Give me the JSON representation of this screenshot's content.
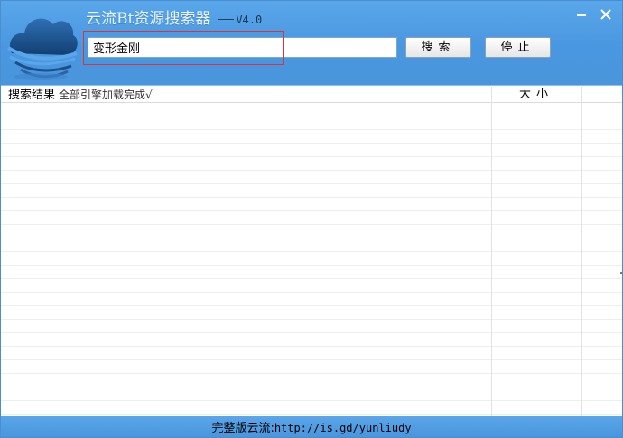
{
  "window": {
    "title": "云流Bt资源搜索器",
    "version": "V4.0"
  },
  "colors": {
    "header_blue": "#4a97e0",
    "highlight_red": "#d2363f",
    "footer_blue": "#4a95dc"
  },
  "icons": {
    "logo": "cloud-logo-icon",
    "minimize": "minimize-icon",
    "close": "close-icon"
  },
  "search": {
    "value": "变形金刚",
    "placeholder": "",
    "search_button": "搜索",
    "stop_button": "停止"
  },
  "results": {
    "header_label": "搜索结果",
    "status": "全部引擎加载完成√",
    "size_column": "大小",
    "rows": []
  },
  "footer": {
    "prefix": "完整版云流:",
    "url": "http://is.gd/yunliudy"
  }
}
